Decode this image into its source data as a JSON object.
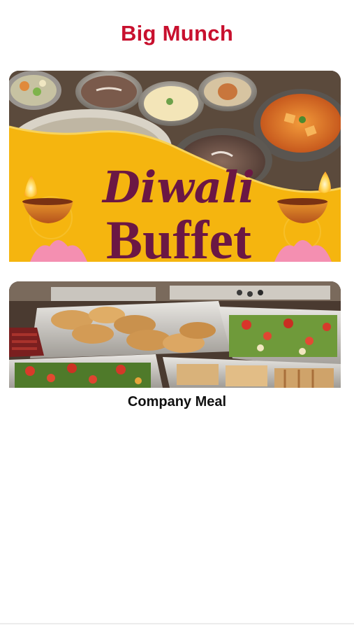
{
  "header": {
    "title": "Big Munch"
  },
  "menu_items": [
    {
      "banner_line1": "Diwali",
      "banner_line2": "Buffet",
      "image_icon": "diwali-buffet-image",
      "label": ""
    },
    {
      "label": "Company Meal",
      "image_icon": "company-meal-image"
    }
  ],
  "colors": {
    "brand": "#c8102e",
    "banner_yellow": "#f5b50f",
    "banner_text": "#6b1744"
  }
}
